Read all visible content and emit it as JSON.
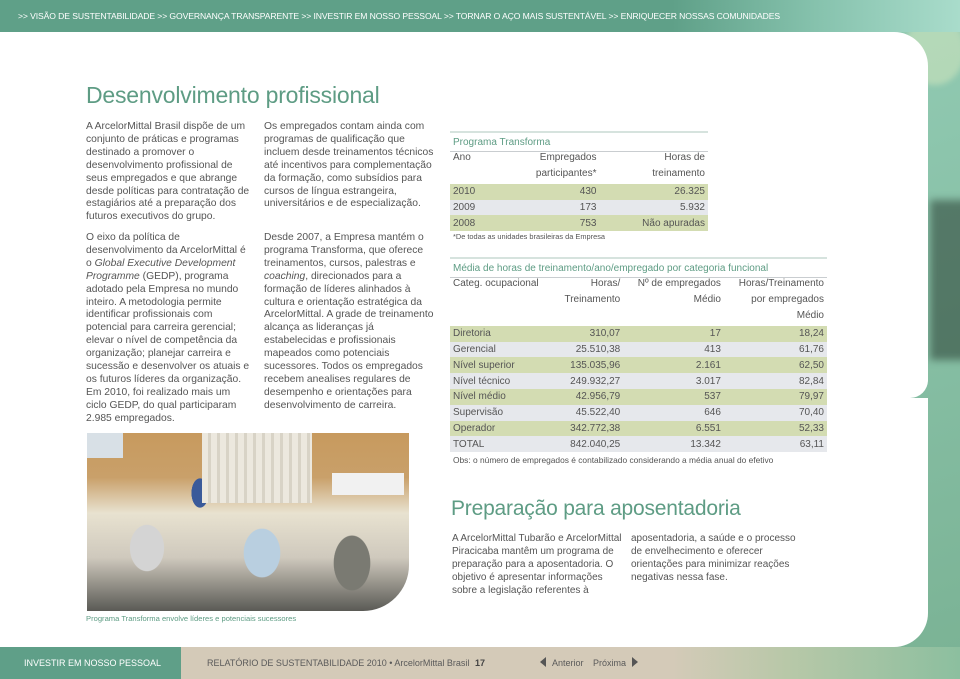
{
  "breadcrumb": [
    ">> VISÃO DE SUSTENTABILIDADE",
    ">> GOVERNANÇA TRANSPARENTE",
    ">> INVESTIR EM NOSSO PESSOAL",
    ">> TORNAR O AÇO MAIS SUSTENTÁVEL",
    ">> ENRIQUECER NOSSAS COMUNIDADES"
  ],
  "section1": {
    "title": "Desenvolvimento profissional",
    "p1": "A ArcelorMittal Brasil dispõe de um conjunto de práticas e programas destinado a promover o desenvolvimento profissional de seus empregados e que abrange desde políticas para contratação de estagiários até a preparação dos futuros executivos do grupo.",
    "p2_pre": "O eixo da política de desenvolvimento da ArcelorMittal é o ",
    "p2_em": "Global Executive Development Programme",
    "p2_post": " (GEDP), programa adotado pela Empresa no mundo inteiro. A metodologia permite identificar profissionais com potencial para carreira gerencial; elevar o nível de competência da organização; planejar carreira e sucessão e desenvolver os atuais e os futuros líderes da organização. Em 2010, foi realizado mais um ciclo GEDP, do qual participaram 2.985 empregados.",
    "p3": "Os empregados contam ainda com programas de qualificação que incluem desde treinamentos técnicos até incentivos para complementação da formação, como subsídios para cursos de língua estrangeira, universitários e de especialização.",
    "p4_pre": "Desde 2007, a Empresa mantém o programa Transforma, que oferece treinamentos, cursos, palestras e ",
    "p4_em": "coaching",
    "p4_post": ", direcionados para a formação de líderes alinhados à cultura e orientação estratégica da ArcelorMittal. A grade de treinamento alcança as lideranças já estabelecidas e profissionais mapeados como potenciais sucessores. Todos os empregados recebem anealises regulares de desempenho e orientações para desenvolvimento de carreira.",
    "photo_caption": "Programa Transforma envolve líderes e potenciais sucessores"
  },
  "table1": {
    "title": "Programa Transforma",
    "headers": [
      [
        "Ano",
        ""
      ],
      [
        "Empregados",
        "participantes*"
      ],
      [
        "Horas de",
        "treinamento"
      ]
    ],
    "rows": [
      [
        "2010",
        "430",
        "26.325"
      ],
      [
        "2009",
        "173",
        "5.932"
      ],
      [
        "2008",
        "753",
        "Não apuradas"
      ]
    ],
    "note": "*De todas as unidades brasileiras da Empresa"
  },
  "table2": {
    "title": "Média de horas de treinamento/ano/empregado por categoria funcional",
    "headers": [
      [
        "Categ. ocupacional",
        "",
        ""
      ],
      [
        "Horas/",
        "Treinamento",
        ""
      ],
      [
        "Nº de empregados",
        "Médio",
        ""
      ],
      [
        "Horas/Treinamento",
        "por empregados",
        "Médio"
      ]
    ],
    "rows": [
      [
        "Diretoria",
        "310,07",
        "17",
        "18,24"
      ],
      [
        "Gerencial",
        "25.510,38",
        "413",
        "61,76"
      ],
      [
        "Nível superior",
        "135.035,96",
        "2.161",
        "62,50"
      ],
      [
        "Nível técnico",
        "249.932,27",
        "3.017",
        "82,84"
      ],
      [
        "Nível médio",
        "42.956,79",
        "537",
        "79,97"
      ],
      [
        "Supervisão",
        "45.522,40",
        "646",
        "70,40"
      ],
      [
        "Operador",
        "342.772,38",
        "6.551",
        "52,33"
      ],
      [
        "TOTAL",
        "842.040,25",
        "13.342",
        "63,11"
      ]
    ],
    "note": "Obs: o número de empregados é contabilizado considerando a média anual do efetivo"
  },
  "section2": {
    "title": "Preparação para aposentadoria",
    "p1": "A ArcelorMittal Tubarão e ArcelorMittal Piracicaba mantêm um programa de preparação para a aposentadoria. O objetivo é apresentar informações sobre a legislação referentes à",
    "p2": "aposentadoria, a saúde e o processo de envelhecimento e oferecer orientações para minimizar reações negativas nessa fase."
  },
  "footer": {
    "section": "INVESTIR EM NOSSO PESSOAL",
    "report": "RELATÓRIO DE SUSTENTABILIDADE 2010 • ArcelorMittal Brasil",
    "page": "17",
    "prev": "Anterior",
    "next": "Próxima"
  },
  "colors": {
    "accent": "#5e9c84",
    "row_green": "#d3dcb2",
    "row_gray": "#e6e8ec",
    "footer_beige": "#d4cab8"
  }
}
